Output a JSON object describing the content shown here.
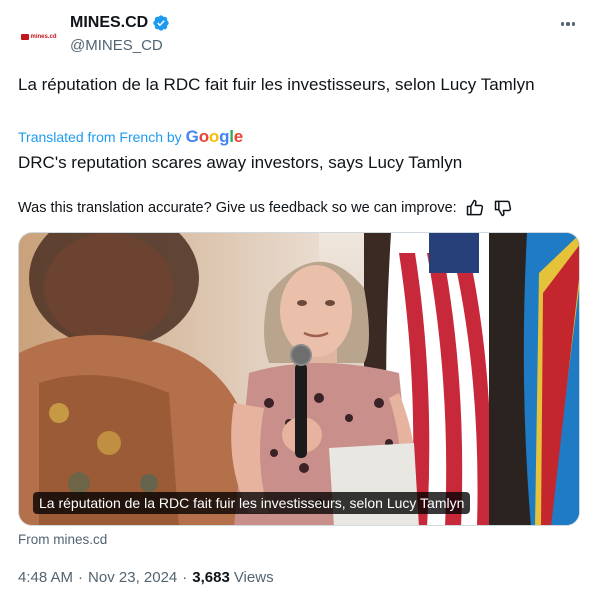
{
  "tweet": {
    "author": {
      "display_name": "MINES.CD",
      "handle": "@MINES_CD",
      "avatar_logo_text": "mines.cd",
      "verified": true
    },
    "original_text": "La réputation de la RDC fait fuir les investisseurs, selon Lucy Tamlyn",
    "translated_from": "Translated from French by",
    "translator_brand": "Google",
    "translated_text": "DRC's reputation scares away investors, says Lucy Tamlyn",
    "feedback_prompt": "Was this translation accurate? Give us feedback so we can improve:",
    "media": {
      "caption": "La réputation de la RDC fait fuir les investisseurs, selon Lucy Tamlyn",
      "source": "From mines.cd"
    },
    "time": "4:48 AM",
    "date": "Nov 23, 2024",
    "separator": "·",
    "views_count": "3,683",
    "views_label": "Views"
  },
  "colors": {
    "link_blue": "#1d9bf0",
    "secondary_text": "#536471",
    "primary_text": "#0f1419",
    "brand_red": "#c0151b"
  }
}
